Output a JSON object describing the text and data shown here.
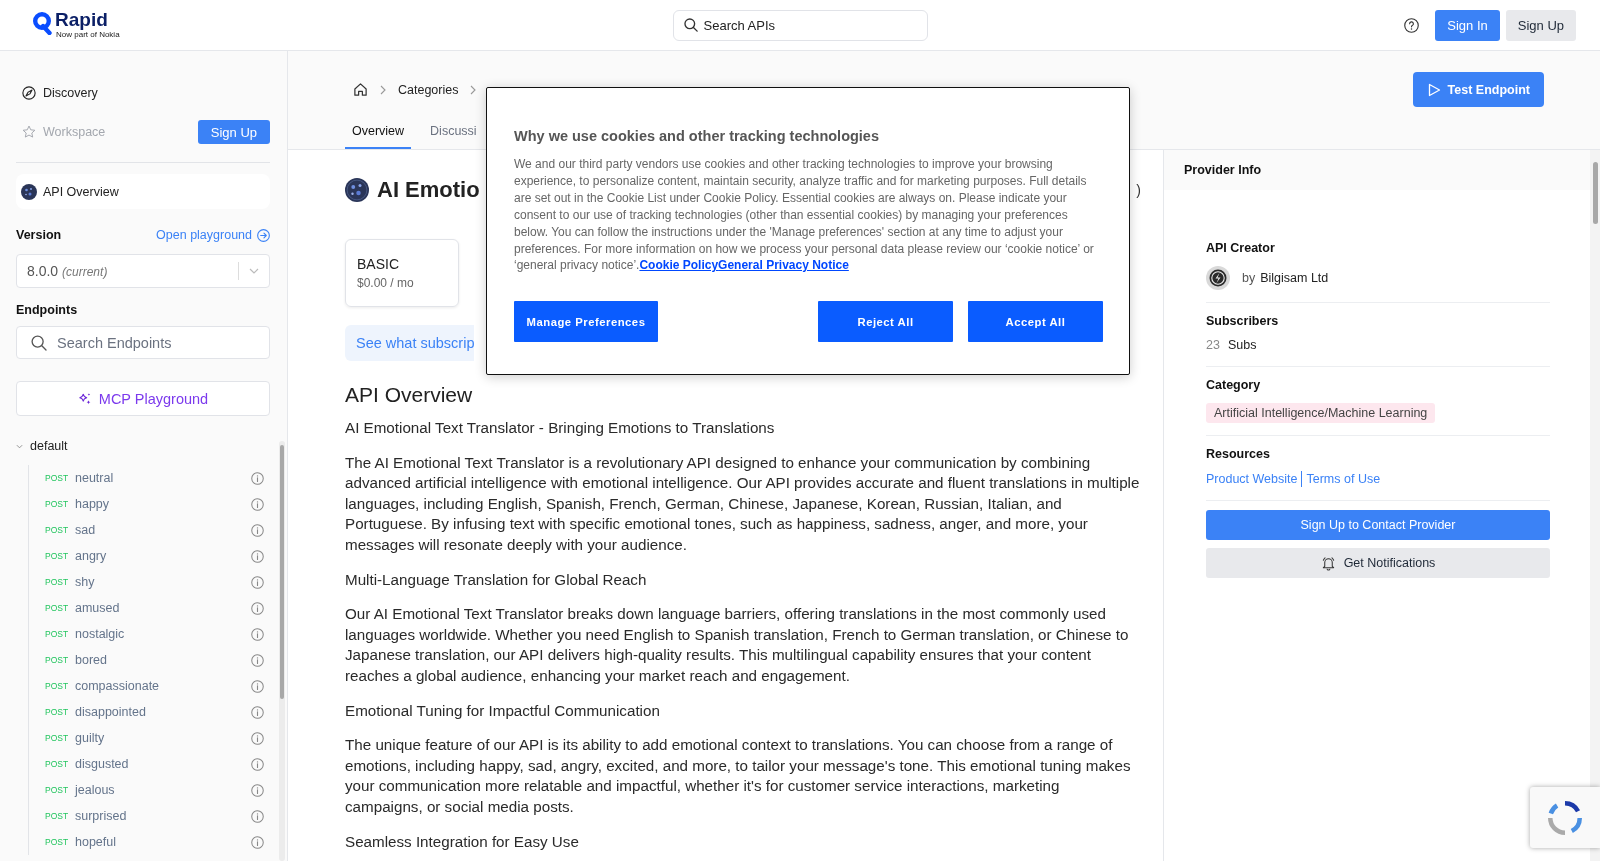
{
  "header": {
    "logo": {
      "name": "Rapid",
      "tagline": "Now part of Nokia"
    },
    "search": {
      "placeholder": "Search APIs"
    },
    "buttons": [
      {
        "label": "Sign In",
        "kind": "primary"
      },
      {
        "label": "Sign Up",
        "kind": "secondary"
      }
    ]
  },
  "sidebar": {
    "nav": [
      {
        "label": "Discovery",
        "disabled": false
      },
      {
        "label": "Workspace",
        "disabled": true
      }
    ],
    "signup_button": "Sign Up",
    "overview_item": {
      "label": "API Overview"
    },
    "version": {
      "label": "Version",
      "link": "Open playground",
      "value": "8.0.0 *(current)*"
    },
    "endpoints": {
      "label": "Endpoints",
      "search": {
        "placeholder": "Search Endpoints"
      },
      "mcp_button": "MCP Playground",
      "groups": [
        {
          "label": "default",
          "expanded": true,
          "children": [
            {
              "method": "POST",
              "name": "neutral"
            },
            {
              "method": "POST",
              "name": "happy"
            },
            {
              "method": "POST",
              "name": "sad"
            },
            {
              "method": "POST",
              "name": "angry"
            },
            {
              "method": "POST",
              "name": "shy"
            },
            {
              "method": "POST",
              "name": "amused"
            },
            {
              "method": "POST",
              "name": "nostalgic"
            },
            {
              "method": "POST",
              "name": "bored"
            },
            {
              "method": "POST",
              "name": "compassionate"
            },
            {
              "method": "POST",
              "name": "disappointed"
            },
            {
              "method": "POST",
              "name": "guilty"
            },
            {
              "method": "POST",
              "name": "disgusted"
            },
            {
              "method": "POST",
              "name": "jealous"
            },
            {
              "method": "POST",
              "name": "surprised"
            },
            {
              "method": "POST",
              "name": "hopeful"
            }
          ]
        }
      ]
    }
  },
  "breadcrumb": {
    "items": [
      "Categories"
    ]
  },
  "tabs": [
    {
      "label": "Overview",
      "selected": true
    },
    {
      "label": "Discussi",
      "selected": false
    }
  ],
  "test_button": "Test Endpoint",
  "api": {
    "title": "AI Emotio",
    "title_tail": ")",
    "plans": [
      {
        "name": "BASIC",
        "price": "$0.00 / mo"
      }
    ],
    "notice": "See what subscrip"
  },
  "overview": {
    "heading": "API Overview",
    "paragraphs": [
      "AI Emotional Text Translator - Bringing Emotions to Translations",
      "The AI Emotional Text Translator is a revolutionary API designed to enhance your communication by combining advanced artificial intelligence with emotional intelligence. Our API provides accurate and fluent translations in multiple languages, including English, Spanish, French, German, Chinese, Japanese, Korean, Russian, Italian, and Portuguese. By infusing text with specific emotional tones, such as happiness, sadness, anger, and more, your messages will resonate deeply with your audience.",
      "Multi-Language Translation for Global Reach",
      "Our AI Emotional Text Translator breaks down language barriers, offering translations in the most commonly used languages worldwide. Whether you need English to Spanish translation, French to German translation, or Chinese to Japanese translation, our API delivers high-quality results. This multilingual capability ensures that your content reaches a global audience, enhancing your market reach and engagement.",
      "Emotional Tuning for Impactful Communication",
      "The unique feature of our API is its ability to add emotional context to translations. You can choose from a range of emotions, including happy, sad, angry, excited, and more, to tailor your message's tone. This emotional tuning makes your communication more relatable and impactful, whether it's for customer service interactions, marketing campaigns, or social media posts.",
      "Seamless Integration for Easy Use"
    ]
  },
  "provider": {
    "title": "Provider Info",
    "creator": {
      "label": "API Creator",
      "prefix": "by",
      "name": "Bilgisam Ltd"
    },
    "subscribers": {
      "label": "Subscribers",
      "count": "23",
      "unit": "Subs"
    },
    "category": {
      "label": "Category",
      "tag": "Artificial Intelligence/Machine Learning"
    },
    "resources": {
      "label": "Resources",
      "links": [
        "Product Website",
        "Terms of Use"
      ]
    },
    "buttons": [
      {
        "label": "Sign Up to Contact Provider",
        "kind": "primary"
      },
      {
        "label": "Get Notifications",
        "kind": "secondary"
      }
    ]
  },
  "cookie_dialog": {
    "title": "Why we use cookies and other tracking technologies",
    "body": "We and our third party vendors use cookies and other tracking technologies to improve your browsing experience, to personalize content, maintain security, analyze traffic and for marketing purposes. Full details are set out in the Cookie List under Cookie Policy. Essential cookies are always on. Please indicate your consent to our use of tracking technologies (other than essential cookies) by managing your preferences below. You can follow the instructions under the 'Manage preferences' section at any time to adjust your preferences. For more information on how we process your personal data please review our ‘cookie notice’ or ‘general privacy notice’.",
    "links": [
      "Cookie Policy",
      "General Privacy Notice"
    ],
    "buttons": [
      "Manage Preferences",
      "Reject All",
      "Accept All"
    ]
  }
}
